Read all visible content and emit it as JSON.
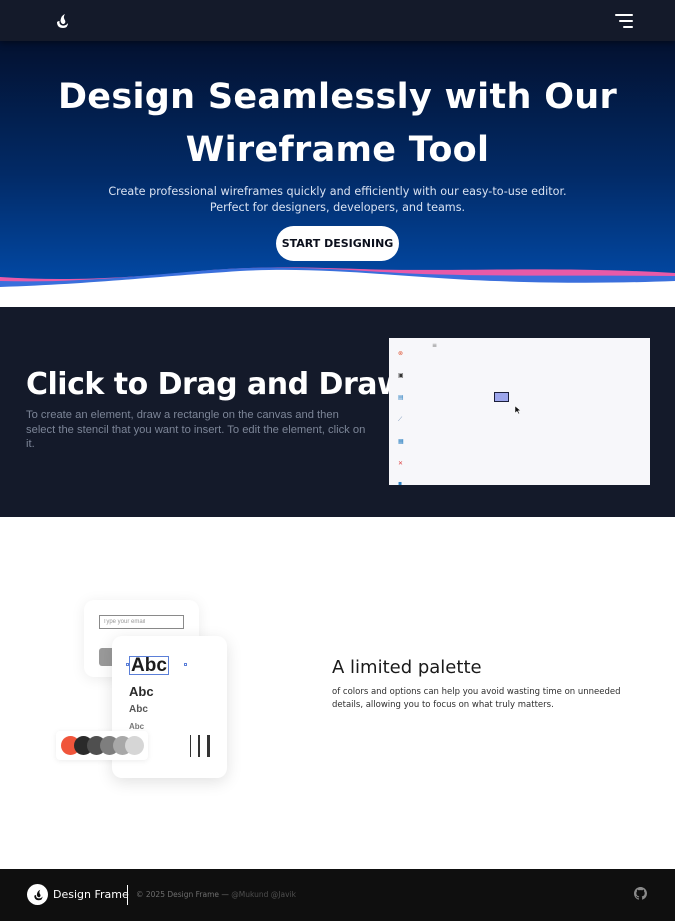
{
  "nav": {
    "logo_icon": "flame-logo-icon",
    "menu_icon": "hamburger-menu-icon"
  },
  "hero": {
    "title_line1": "Design Seamlessly with Our",
    "title_line2": "Wireframe Tool",
    "subtitle_line1": "Create professional wireframes quickly and efficiently with our easy-to-use editor.",
    "subtitle_line2": "Perfect for designers, developers, and teams.",
    "cta_label": "START DESIGNING",
    "colors": {
      "background": "#022a66",
      "wave_pink": "#e85aa8",
      "wave_blue": "#3a6fdc"
    }
  },
  "drag_section": {
    "title": "Click to Drag and Draw",
    "description": "To create an element, draw a rectangle on the canvas and then select the stencil that you want to insert. To edit the element, click on it.",
    "canvas_tools": [
      "target-icon",
      "image-icon",
      "text-icon",
      "pencil-icon",
      "table-icon",
      "close-icon",
      "shape-icon"
    ]
  },
  "palette_section": {
    "title": "A limited palette",
    "description": "of colors and options can help you avoid wasting time on unneeded details, allowing you to focus on what truly matters.",
    "email_placeholder": "Type your email",
    "button_label": "O",
    "text_samples": [
      "Abc",
      "Abc",
      "Abc",
      "Abc"
    ],
    "swatches": [
      "#f0553b",
      "#2a2a2a",
      "#4f4f4f",
      "#7e7e7e",
      "#a8a8a8",
      "#d6d6d6"
    ]
  },
  "footer": {
    "brand": "Design Frame",
    "copyright": "© 2025 Design Frame —",
    "author1": "@Mukund",
    "author2": "@Javik",
    "github_icon": "github-icon"
  }
}
